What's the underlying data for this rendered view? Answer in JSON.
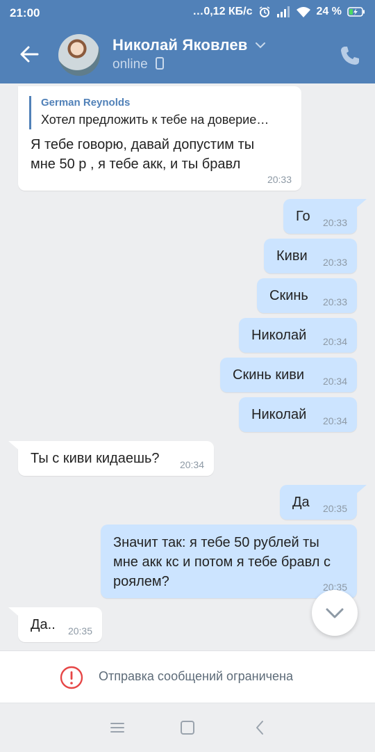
{
  "status_bar": {
    "time": "21:00",
    "speed": "…0,12 КБ/с",
    "battery": "24 %"
  },
  "header": {
    "contact_name": "Николай Яковлев",
    "status": "online",
    "icons": [
      "back-arrow-icon",
      "chevron-down-icon",
      "mobile-device-icon",
      "phone-icon"
    ]
  },
  "messages": [
    {
      "direction": "in",
      "reply_author": "German Reynolds",
      "reply_text": "Хотел предложить к тебе на доверие…",
      "text_lines": [
        "Я тебе говорю, давай допустим ты",
        "мне 50 р , я тебе акк, и ты бравл"
      ],
      "time": "20:33"
    },
    {
      "direction": "out",
      "text": "Го",
      "time": "20:33"
    },
    {
      "direction": "out",
      "text": "Киви",
      "time": "20:33"
    },
    {
      "direction": "out",
      "text": "Скинь",
      "time": "20:33"
    },
    {
      "direction": "out",
      "text": "Николай",
      "time": "20:34"
    },
    {
      "direction": "out",
      "text": "Скинь киви",
      "time": "20:34"
    },
    {
      "direction": "out",
      "text": "Николай",
      "time": "20:34"
    },
    {
      "direction": "in",
      "text": "Ты с киви кидаешь?",
      "time": "20:34"
    },
    {
      "direction": "out",
      "text": "Да",
      "time": "20:35"
    },
    {
      "direction": "out",
      "text_lines": [
        "Значит так: я тебе 50 рублей ты",
        "мне акк кс и потом я тебе бравл с",
        "роялем?"
      ],
      "time": "20:35"
    },
    {
      "direction": "in",
      "text": "Да..",
      "time": "20:35"
    }
  ],
  "footer": {
    "restricted_text": "Отправка сообщений ограничена"
  },
  "colors": {
    "accent": "#5181b8",
    "outgoing_bubble": "#cce4ff",
    "background": "#edeef0",
    "warning": "#e64646"
  }
}
